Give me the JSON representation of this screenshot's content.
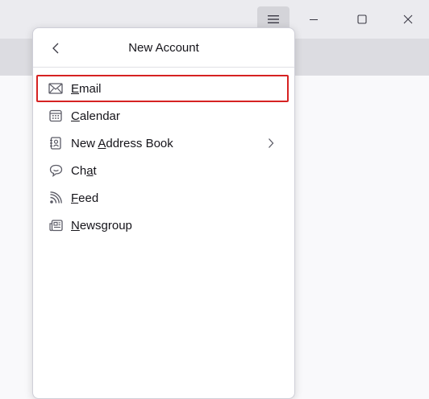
{
  "panel": {
    "title": "New Account",
    "items": [
      {
        "label": "Email",
        "icon": "envelope-icon",
        "access_key": "E",
        "selected": true
      },
      {
        "label": "Calendar",
        "icon": "calendar-icon",
        "access_key": "C"
      },
      {
        "label": "New Address Book",
        "icon": "address-book-icon",
        "access_key": "A",
        "submenu": true
      },
      {
        "label": "Chat",
        "icon": "chat-icon",
        "access_key": "a"
      },
      {
        "label": "Feed",
        "icon": "feed-icon",
        "access_key": "F"
      },
      {
        "label": "Newsgroup",
        "icon": "newsgroup-icon",
        "access_key": "N"
      }
    ]
  },
  "colors": {
    "highlight_outline": "#d62222",
    "icon_color": "#5b5b66"
  }
}
